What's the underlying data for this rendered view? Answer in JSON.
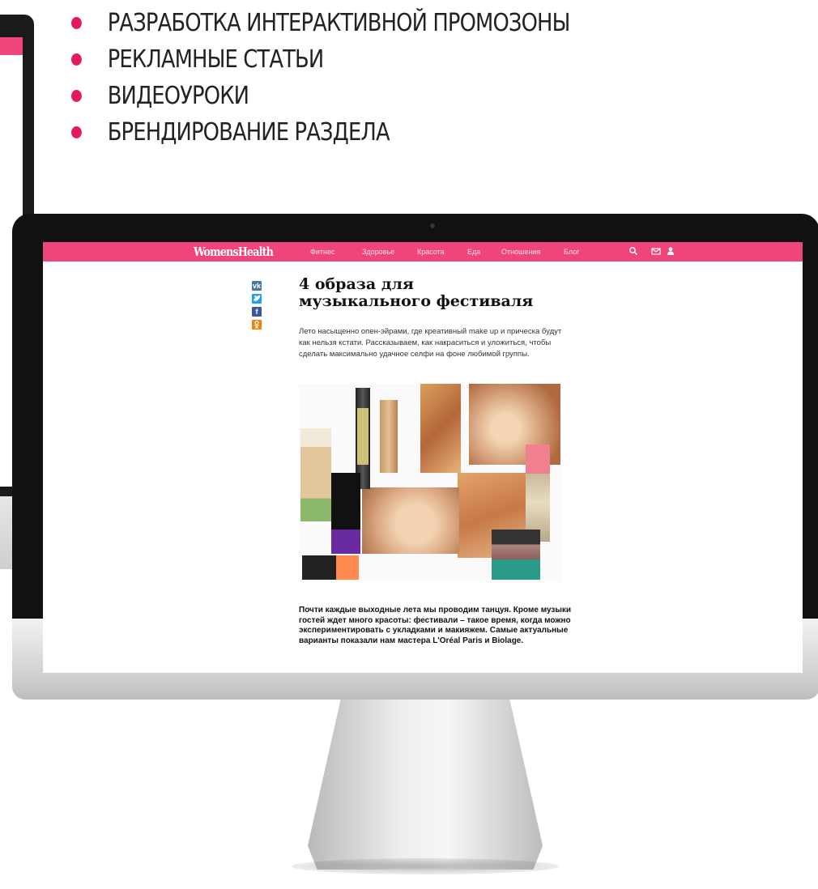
{
  "features": [
    "РАЗРАБОТКА  ИНТЕРАКТИВНОЙ ПРОМОЗОНЫ",
    "РЕКЛАМНЫЕ СТАТЬИ",
    "ВИДЕОУРОКИ",
    "БРЕНДИРОВАНИЕ РАЗДЕЛА"
  ],
  "site": {
    "brand": "WomensHealth",
    "nav": [
      "Фитнес",
      "Здоровье",
      "Красота",
      "Еда",
      "Отношения",
      "Блог"
    ],
    "header_icons": [
      "search-icon",
      "mail-icon",
      "user-icon"
    ],
    "share": [
      {
        "name": "vk-share-icon",
        "glyph": "vk",
        "color": "#4c75a3"
      },
      {
        "name": "twitter-share-icon",
        "glyph": "t",
        "color": "#1da1f2"
      },
      {
        "name": "facebook-share-icon",
        "glyph": "f",
        "color": "#3b5998"
      },
      {
        "name": "odnoklassniki-share-icon",
        "glyph": "ok",
        "color": "#ee8208"
      }
    ]
  },
  "article": {
    "title_line1": "4 образа для",
    "title_line2": "музыкального фестиваля",
    "lead": "Лето насыщенно опен-эйрами, где креативный make up и прическа будут как нельзя кстати. Рассказываем, как накраситься и уложиться, чтобы сделать максимально удачное селфи на фоне любимой группы.",
    "body": "Почти каждые выходные лета мы проводим танцуя. Кроме музыки гостей ждет много красоты: фестивали – такое время, когда можно экспериментировать с укладками и макияжем. Самые актуальные варианты показали нам мастера L'Oréal Paris и Biolage."
  },
  "colors": {
    "brand_pink": "#f0457a",
    "bullet": "#e31b5b"
  }
}
